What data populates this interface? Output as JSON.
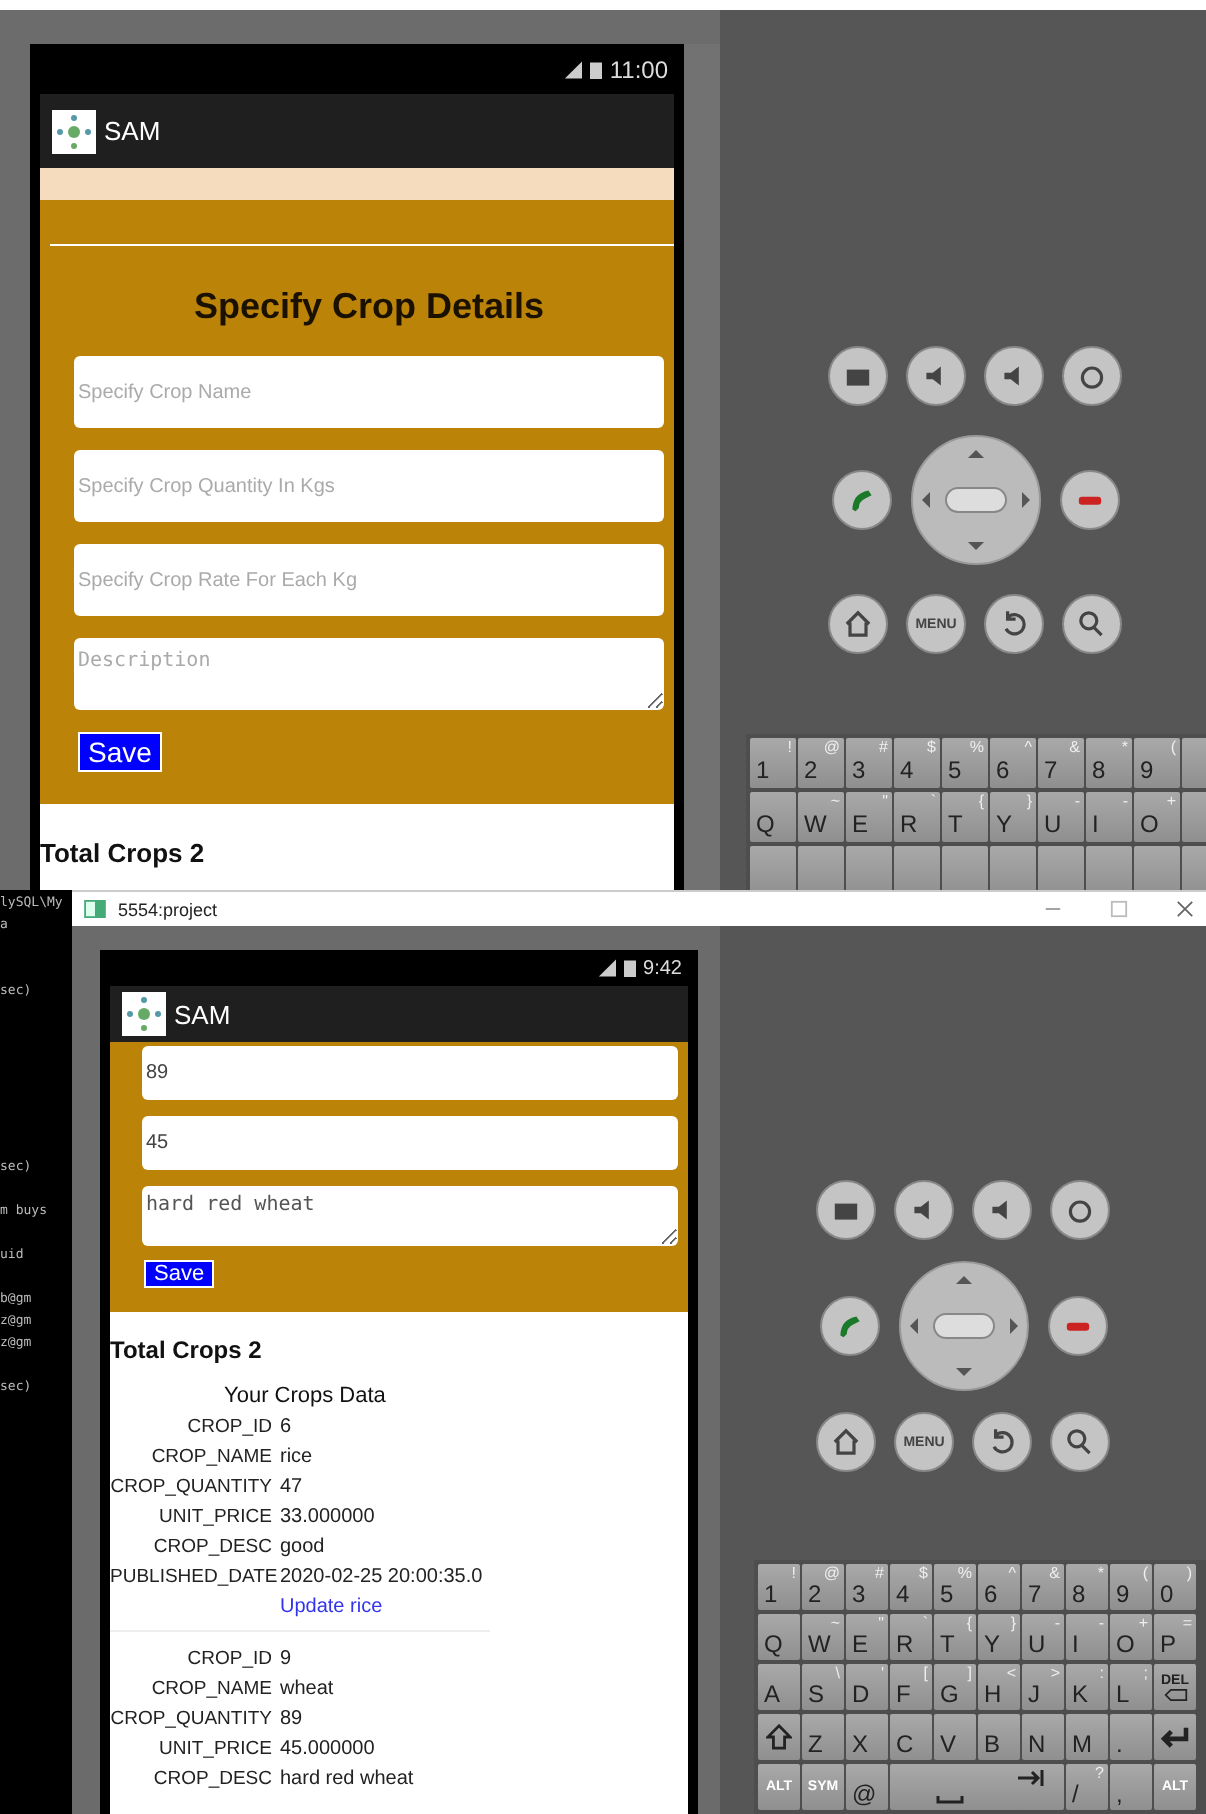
{
  "top_emulator": {
    "status_time": "11:00",
    "app_title": "SAM",
    "form_title": "Specify Crop Details",
    "fields": [
      {
        "kind": "input",
        "placeholder": "Specify Crop Name"
      },
      {
        "kind": "input",
        "placeholder": "Specify Crop Quantity In Kgs"
      },
      {
        "kind": "input",
        "placeholder": "Specify Crop Rate For Each Kg"
      },
      {
        "kind": "textarea",
        "placeholder": "Description"
      }
    ],
    "save_button": "Save",
    "total_label": "Total Crops 2",
    "hardware_buttons": [
      [
        {
          "kind": "camera"
        },
        {
          "kind": "volume-down"
        },
        {
          "kind": "volume-up"
        },
        {
          "kind": "power"
        }
      ],
      [
        {
          "kind": "call"
        },
        {
          "kind": "dpad"
        },
        {
          "kind": "end-call"
        }
      ],
      [
        {
          "kind": "home"
        },
        {
          "kind": "menu",
          "label": "MENU"
        },
        {
          "kind": "back"
        },
        {
          "kind": "search"
        }
      ]
    ],
    "keyboard": [
      [
        {
          "kind": "char",
          "label": "1",
          "alt": "!"
        },
        {
          "kind": "char",
          "label": "2",
          "alt": "@"
        },
        {
          "kind": "char",
          "label": "3",
          "alt": "#"
        },
        {
          "kind": "char",
          "label": "4",
          "alt": "$"
        },
        {
          "kind": "char",
          "label": "5",
          "alt": "%"
        },
        {
          "kind": "char",
          "label": "6",
          "alt": "^"
        },
        {
          "kind": "char",
          "label": "7",
          "alt": "&"
        },
        {
          "kind": "char",
          "label": "8",
          "alt": "*"
        },
        {
          "kind": "char",
          "label": "9",
          "alt": "("
        },
        {
          "kind": "blank"
        }
      ],
      [
        {
          "kind": "char",
          "label": "Q"
        },
        {
          "kind": "char",
          "label": "W",
          "alt": "~"
        },
        {
          "kind": "char",
          "label": "E",
          "alt": "\""
        },
        {
          "kind": "char",
          "label": "R",
          "alt": "`"
        },
        {
          "kind": "char",
          "label": "T",
          "alt": "{"
        },
        {
          "kind": "char",
          "label": "Y",
          "alt": "}"
        },
        {
          "kind": "char",
          "label": "U",
          "alt": "-"
        },
        {
          "kind": "char",
          "label": "I",
          "alt": "-"
        },
        {
          "kind": "char",
          "label": "O",
          "alt": "+"
        },
        {
          "kind": "blank"
        }
      ],
      [
        {
          "kind": "blank"
        },
        {
          "kind": "blank"
        },
        {
          "kind": "blank"
        },
        {
          "kind": "blank"
        },
        {
          "kind": "blank"
        },
        {
          "kind": "blank"
        },
        {
          "kind": "blank"
        },
        {
          "kind": "blank"
        },
        {
          "kind": "blank"
        },
        {
          "kind": "blank"
        }
      ]
    ]
  },
  "bottom_window": {
    "title": "5554:project",
    "console_lines": [
      {
        "kind": "text",
        "text": "lySQL\\My"
      },
      {
        "kind": "text",
        "text": "a"
      },
      {
        "kind": "blank"
      },
      {
        "kind": "blank"
      },
      {
        "kind": "text",
        "text": "sec)"
      },
      {
        "kind": "blank"
      },
      {
        "kind": "blank"
      },
      {
        "kind": "blank"
      },
      {
        "kind": "blank"
      },
      {
        "kind": "blank"
      },
      {
        "kind": "blank"
      },
      {
        "kind": "blank"
      },
      {
        "kind": "text",
        "text": "sec)"
      },
      {
        "kind": "blank"
      },
      {
        "kind": "text",
        "text": "m buys"
      },
      {
        "kind": "blank"
      },
      {
        "kind": "text",
        "text": "uid"
      },
      {
        "kind": "blank"
      },
      {
        "kind": "text",
        "text": "b@gm"
      },
      {
        "kind": "text",
        "text": "z@gm"
      },
      {
        "kind": "text",
        "text": "z@gm"
      },
      {
        "kind": "blank"
      },
      {
        "kind": "text",
        "text": "sec)"
      }
    ],
    "status_time": "9:42",
    "app_title": "SAM",
    "fields": [
      {
        "kind": "input",
        "value": "89"
      },
      {
        "kind": "input",
        "value": "45"
      },
      {
        "kind": "textarea",
        "value": "hard red wheat"
      }
    ],
    "save_button": "Save",
    "total_label": "Total Crops 2",
    "table_title": "Your Crops Data",
    "records": [
      {
        "fields": [
          {
            "label": "CROP_ID",
            "value": "6"
          },
          {
            "label": "CROP_NAME",
            "value": "rice"
          },
          {
            "label": "CROP_QUANTITY",
            "value": "47"
          },
          {
            "label": "UNIT_PRICE",
            "value": "33.000000"
          },
          {
            "label": "CROP_DESC",
            "value": "good"
          },
          {
            "label": "PUBLISHED_DATE",
            "value": "2020-02-25 20:00:35.0"
          }
        ],
        "link": "Update rice"
      },
      {
        "fields": [
          {
            "label": "CROP_ID",
            "value": "9"
          },
          {
            "label": "CROP_NAME",
            "value": "wheat"
          },
          {
            "label": "CROP_QUANTITY",
            "value": "89"
          },
          {
            "label": "UNIT_PRICE",
            "value": "45.000000"
          },
          {
            "label": "CROP_DESC",
            "value": "hard red wheat"
          }
        ]
      }
    ],
    "hardware_buttons": [
      [
        {
          "kind": "camera"
        },
        {
          "kind": "volume-down"
        },
        {
          "kind": "volume-up"
        },
        {
          "kind": "power"
        }
      ],
      [
        {
          "kind": "call"
        },
        {
          "kind": "dpad"
        },
        {
          "kind": "end-call"
        }
      ],
      [
        {
          "kind": "home"
        },
        {
          "kind": "menu",
          "label": "MENU"
        },
        {
          "kind": "back"
        },
        {
          "kind": "search"
        }
      ]
    ],
    "keyboard": [
      [
        {
          "kind": "char",
          "label": "1",
          "alt": "!"
        },
        {
          "kind": "char",
          "label": "2",
          "alt": "@"
        },
        {
          "kind": "char",
          "label": "3",
          "alt": "#"
        },
        {
          "kind": "char",
          "label": "4",
          "alt": "$"
        },
        {
          "kind": "char",
          "label": "5",
          "alt": "%"
        },
        {
          "kind": "char",
          "label": "6",
          "alt": "^"
        },
        {
          "kind": "char",
          "label": "7",
          "alt": "&"
        },
        {
          "kind": "char",
          "label": "8",
          "alt": "*"
        },
        {
          "kind": "char",
          "label": "9",
          "alt": "("
        },
        {
          "kind": "char",
          "label": "0",
          "alt": ")"
        }
      ],
      [
        {
          "kind": "char",
          "label": "Q"
        },
        {
          "kind": "char",
          "label": "W",
          "alt": "~"
        },
        {
          "kind": "char",
          "label": "E",
          "alt": "\""
        },
        {
          "kind": "char",
          "label": "R",
          "alt": "`"
        },
        {
          "kind": "char",
          "label": "T",
          "alt": "{"
        },
        {
          "kind": "char",
          "label": "Y",
          "alt": "}"
        },
        {
          "kind": "char",
          "label": "U",
          "alt": "-"
        },
        {
          "kind": "char",
          "label": "I",
          "alt": "-"
        },
        {
          "kind": "char",
          "label": "O",
          "alt": "+"
        },
        {
          "kind": "char",
          "label": "P",
          "alt": "="
        }
      ],
      [
        {
          "kind": "char",
          "label": "A"
        },
        {
          "kind": "char",
          "label": "S",
          "alt": "\\"
        },
        {
          "kind": "char",
          "label": "D",
          "alt": "'"
        },
        {
          "kind": "char",
          "label": "F",
          "alt": "["
        },
        {
          "kind": "char",
          "label": "G",
          "alt": "]"
        },
        {
          "kind": "char",
          "label": "H",
          "alt": "<"
        },
        {
          "kind": "char",
          "label": "J",
          "alt": ">"
        },
        {
          "kind": "char",
          "label": "K",
          "alt": ":"
        },
        {
          "kind": "char",
          "label": "L",
          "alt": ";"
        },
        {
          "kind": "del",
          "label": "DEL"
        }
      ],
      [
        {
          "kind": "shift"
        },
        {
          "kind": "char",
          "label": "Z"
        },
        {
          "kind": "char",
          "label": "X"
        },
        {
          "kind": "char",
          "label": "C"
        },
        {
          "kind": "char",
          "label": "V"
        },
        {
          "kind": "char",
          "label": "B"
        },
        {
          "kind": "char",
          "label": "N"
        },
        {
          "kind": "char",
          "label": "M"
        },
        {
          "kind": "char",
          "label": "."
        },
        {
          "kind": "enter"
        }
      ],
      [
        {
          "kind": "mod",
          "label": "ALT"
        },
        {
          "kind": "mod",
          "label": "SYM"
        },
        {
          "kind": "char",
          "label": "@"
        },
        {
          "kind": "space"
        },
        {
          "kind": "char",
          "label": "/",
          "alt": "?"
        },
        {
          "kind": "char",
          "label": ","
        },
        {
          "kind": "mod",
          "label": "ALT"
        }
      ]
    ]
  }
}
